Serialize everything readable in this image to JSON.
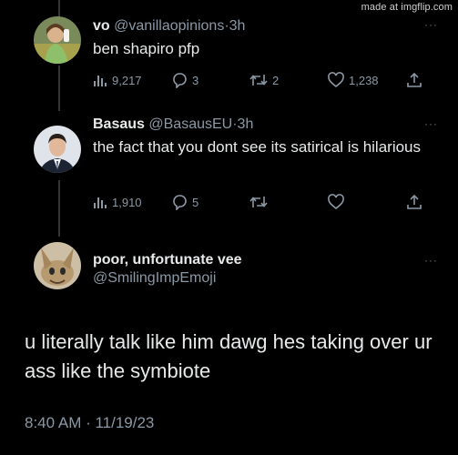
{
  "watermark": "made at imgflip.com",
  "tweets": [
    {
      "name": "vo",
      "handle": "@vanillaopinions",
      "separator": "·",
      "time": "3h",
      "text": "ben shapiro pfp",
      "views": "9,217",
      "replies": "3",
      "retweets": "2",
      "likes": "1,238",
      "avatar_icon": "woman-avatar"
    },
    {
      "name": "Basaus",
      "handle": "@BasausEU",
      "separator": "·",
      "time": "3h",
      "text": "the fact that you dont see its satirical is hilarious",
      "views": "1,910",
      "replies": "5",
      "retweets": "",
      "likes": "",
      "avatar_icon": "man-in-suit-avatar"
    }
  ],
  "main_tweet": {
    "name": "poor, unfortunate vee",
    "handle": "@SmilingImpEmoji",
    "text": "u literally talk like him dawg hes taking over ur ass like the symbiote",
    "timestamp": "8:40 AM · 11/19/23",
    "avatar_icon": "cartoon-character-avatar"
  },
  "more_label": "···",
  "colors": {
    "background": "#000000",
    "primary_text": "#e7e9ea",
    "secondary_text": "#8b98a5",
    "thread_line": "#333639"
  },
  "icons": [
    "views-icon",
    "reply-icon",
    "retweet-icon",
    "like-icon",
    "share-icon",
    "more-icon"
  ]
}
